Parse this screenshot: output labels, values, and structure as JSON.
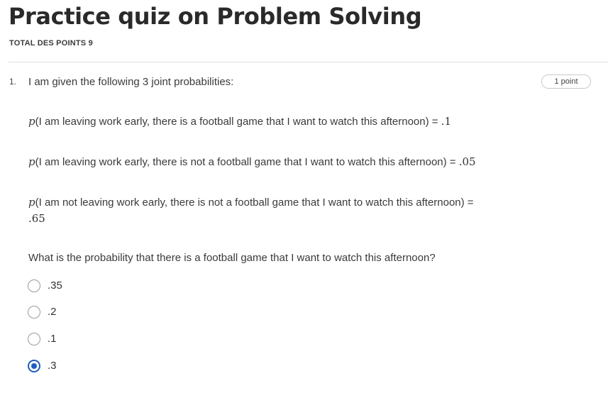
{
  "quiz": {
    "title": "Practice quiz on Problem Solving",
    "total_points": "TOTAL DES POINTS 9"
  },
  "question": {
    "number": "1.",
    "points": "1 point",
    "intro": "I am given the following 3 joint probabilities:",
    "probabilities": [
      {
        "p": "p",
        "text": "(I am leaving work early, there is a football game that I want to watch this afternoon) = ",
        "value": ".1"
      },
      {
        "p": "p",
        "text": "(I am leaving work early, there is not a football game that I want to watch this afternoon) = ",
        "value": ".05"
      },
      {
        "p": "p",
        "text": "(I am not leaving work early, there is not a football game that I want to watch this afternoon) = ",
        "value": ".65"
      }
    ],
    "prompt": "What is the probability that there is a football game that I want to watch this afternoon?",
    "options": [
      {
        "label": ".35",
        "selected": false
      },
      {
        "label": ".2",
        "selected": false
      },
      {
        "label": ".1",
        "selected": false
      },
      {
        "label": ".3",
        "selected": true
      }
    ],
    "accent_color": "#1f5fbf"
  }
}
